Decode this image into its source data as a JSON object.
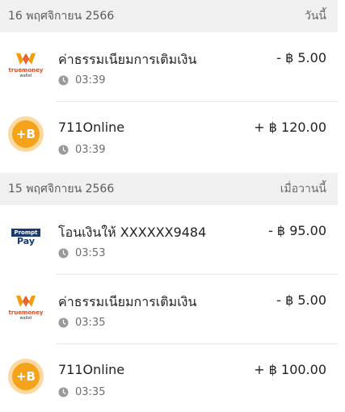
{
  "sections": [
    {
      "date": "16 พฤศจิกายน 2566",
      "label": "วันนี้",
      "items": [
        {
          "logo": "truemoney-wallet-logo",
          "logo_brand": "truemoney",
          "logo_sub": "wallet",
          "title": "ค่าธรรมเนียมการเติมเงิน",
          "amount": "- ฿ 5.00",
          "time": "03:39"
        },
        {
          "logo": "baht-coin-logo",
          "logo_text": "+B",
          "title": "711Online",
          "amount": "+ ฿ 120.00",
          "time": "03:39"
        }
      ]
    },
    {
      "date": "15 พฤศจิกายน 2566",
      "label": "เมื่อวานนี้",
      "items": [
        {
          "logo": "promptpay-logo",
          "logo_top": "Prompt",
          "logo_bottom": "Pay",
          "title": "โอนเงินให้  XXXXXX9484",
          "amount": "- ฿ 95.00",
          "time": "03:53"
        },
        {
          "logo": "truemoney-wallet-logo",
          "logo_brand": "truemoney",
          "logo_sub": "wallet",
          "title": "ค่าธรรมเนียมการเติมเงิน",
          "amount": "- ฿ 5.00",
          "time": "03:35"
        },
        {
          "logo": "baht-coin-logo",
          "logo_text": "+B",
          "title": "711Online",
          "amount": "+ ฿ 100.00",
          "time": "03:35"
        }
      ]
    }
  ],
  "colors": {
    "header_bg": "#f0f0f0",
    "coin": "#f4a31b",
    "truemoney": "#e64a19",
    "promptpay": "#1b3b6f"
  }
}
